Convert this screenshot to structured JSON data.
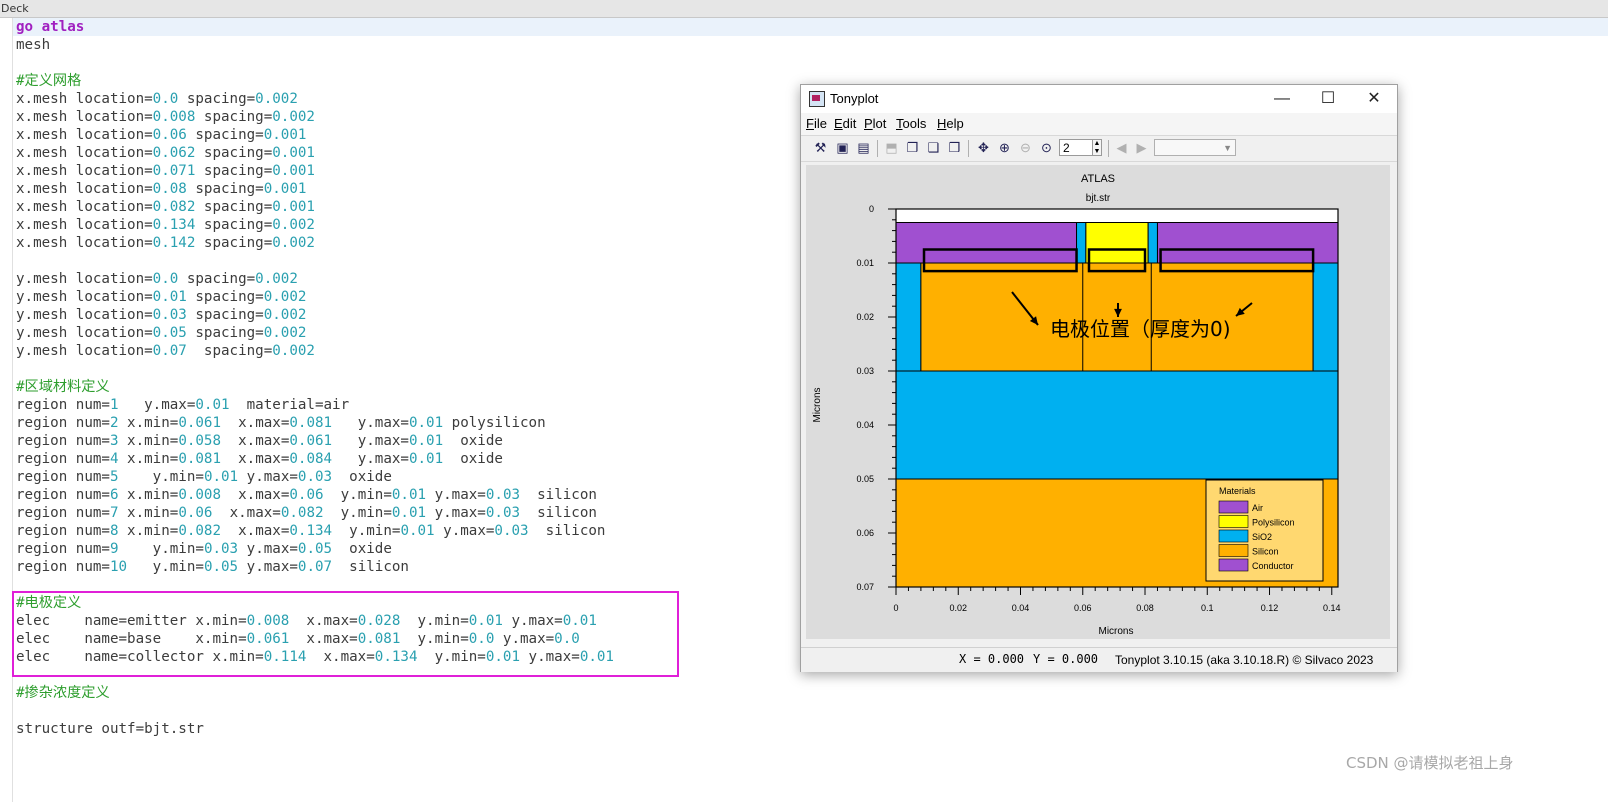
{
  "editor": {
    "tab_label": "Deck",
    "lines": [
      [
        {
          "t": "go atlas",
          "c": "kw"
        }
      ],
      [
        {
          "t": "mesh"
        }
      ],
      [],
      [
        {
          "t": "#定义网格",
          "c": "cmt"
        }
      ],
      [
        {
          "t": "x.mesh location="
        },
        {
          "t": "0.0",
          "c": "num"
        },
        {
          "t": " spacing="
        },
        {
          "t": "0.002",
          "c": "num"
        }
      ],
      [
        {
          "t": "x.mesh location="
        },
        {
          "t": "0.008",
          "c": "num"
        },
        {
          "t": " spacing="
        },
        {
          "t": "0.002",
          "c": "num"
        }
      ],
      [
        {
          "t": "x.mesh location="
        },
        {
          "t": "0.06",
          "c": "num"
        },
        {
          "t": " spacing="
        },
        {
          "t": "0.001",
          "c": "num"
        }
      ],
      [
        {
          "t": "x.mesh location="
        },
        {
          "t": "0.062",
          "c": "num"
        },
        {
          "t": " spacing="
        },
        {
          "t": "0.001",
          "c": "num"
        }
      ],
      [
        {
          "t": "x.mesh location="
        },
        {
          "t": "0.071",
          "c": "num"
        },
        {
          "t": " spacing="
        },
        {
          "t": "0.001",
          "c": "num"
        }
      ],
      [
        {
          "t": "x.mesh location="
        },
        {
          "t": "0.08",
          "c": "num"
        },
        {
          "t": " spacing="
        },
        {
          "t": "0.001",
          "c": "num"
        }
      ],
      [
        {
          "t": "x.mesh location="
        },
        {
          "t": "0.082",
          "c": "num"
        },
        {
          "t": " spacing="
        },
        {
          "t": "0.001",
          "c": "num"
        }
      ],
      [
        {
          "t": "x.mesh location="
        },
        {
          "t": "0.134",
          "c": "num"
        },
        {
          "t": " spacing="
        },
        {
          "t": "0.002",
          "c": "num"
        }
      ],
      [
        {
          "t": "x.mesh location="
        },
        {
          "t": "0.142",
          "c": "num"
        },
        {
          "t": " spacing="
        },
        {
          "t": "0.002",
          "c": "num"
        }
      ],
      [],
      [
        {
          "t": "y.mesh location="
        },
        {
          "t": "0.0",
          "c": "num"
        },
        {
          "t": " spacing="
        },
        {
          "t": "0.002",
          "c": "num"
        }
      ],
      [
        {
          "t": "y.mesh location="
        },
        {
          "t": "0.01",
          "c": "num"
        },
        {
          "t": " spacing="
        },
        {
          "t": "0.002",
          "c": "num"
        }
      ],
      [
        {
          "t": "y.mesh location="
        },
        {
          "t": "0.03",
          "c": "num"
        },
        {
          "t": " spacing="
        },
        {
          "t": "0.002",
          "c": "num"
        }
      ],
      [
        {
          "t": "y.mesh location="
        },
        {
          "t": "0.05",
          "c": "num"
        },
        {
          "t": " spacing="
        },
        {
          "t": "0.002",
          "c": "num"
        }
      ],
      [
        {
          "t": "y.mesh location="
        },
        {
          "t": "0.07",
          "c": "num"
        },
        {
          "t": "  spacing="
        },
        {
          "t": "0.002",
          "c": "num"
        }
      ],
      [],
      [
        {
          "t": "#区域材料定义",
          "c": "cmt"
        }
      ],
      [
        {
          "t": "region num="
        },
        {
          "t": "1",
          "c": "num"
        },
        {
          "t": "   y.max="
        },
        {
          "t": "0.01",
          "c": "num"
        },
        {
          "t": "  material=air"
        }
      ],
      [
        {
          "t": "region num="
        },
        {
          "t": "2",
          "c": "num"
        },
        {
          "t": " x.min="
        },
        {
          "t": "0.061",
          "c": "num"
        },
        {
          "t": "  x.max="
        },
        {
          "t": "0.081",
          "c": "num"
        },
        {
          "t": "   y.max="
        },
        {
          "t": "0.01",
          "c": "num"
        },
        {
          "t": " polysilicon"
        }
      ],
      [
        {
          "t": "region num="
        },
        {
          "t": "3",
          "c": "num"
        },
        {
          "t": " x.min="
        },
        {
          "t": "0.058",
          "c": "num"
        },
        {
          "t": "  x.max="
        },
        {
          "t": "0.061",
          "c": "num"
        },
        {
          "t": "   y.max="
        },
        {
          "t": "0.01",
          "c": "num"
        },
        {
          "t": "  oxide"
        }
      ],
      [
        {
          "t": "region num="
        },
        {
          "t": "4",
          "c": "num"
        },
        {
          "t": " x.min="
        },
        {
          "t": "0.081",
          "c": "num"
        },
        {
          "t": "  x.max="
        },
        {
          "t": "0.084",
          "c": "num"
        },
        {
          "t": "   y.max="
        },
        {
          "t": "0.01",
          "c": "num"
        },
        {
          "t": "  oxide"
        }
      ],
      [
        {
          "t": "region num="
        },
        {
          "t": "5",
          "c": "num"
        },
        {
          "t": "    y.min="
        },
        {
          "t": "0.01",
          "c": "num"
        },
        {
          "t": " y.max="
        },
        {
          "t": "0.03",
          "c": "num"
        },
        {
          "t": "  oxide"
        }
      ],
      [
        {
          "t": "region num="
        },
        {
          "t": "6",
          "c": "num"
        },
        {
          "t": " x.min="
        },
        {
          "t": "0.008",
          "c": "num"
        },
        {
          "t": "  x.max="
        },
        {
          "t": "0.06",
          "c": "num"
        },
        {
          "t": "  y.min="
        },
        {
          "t": "0.01",
          "c": "num"
        },
        {
          "t": " y.max="
        },
        {
          "t": "0.03",
          "c": "num"
        },
        {
          "t": "  silicon"
        }
      ],
      [
        {
          "t": "region num="
        },
        {
          "t": "7",
          "c": "num"
        },
        {
          "t": " x.min="
        },
        {
          "t": "0.06",
          "c": "num"
        },
        {
          "t": "  x.max="
        },
        {
          "t": "0.082",
          "c": "num"
        },
        {
          "t": "  y.min="
        },
        {
          "t": "0.01",
          "c": "num"
        },
        {
          "t": " y.max="
        },
        {
          "t": "0.03",
          "c": "num"
        },
        {
          "t": "  silicon"
        }
      ],
      [
        {
          "t": "region num="
        },
        {
          "t": "8",
          "c": "num"
        },
        {
          "t": " x.min="
        },
        {
          "t": "0.082",
          "c": "num"
        },
        {
          "t": "  x.max="
        },
        {
          "t": "0.134",
          "c": "num"
        },
        {
          "t": "  y.min="
        },
        {
          "t": "0.01",
          "c": "num"
        },
        {
          "t": " y.max="
        },
        {
          "t": "0.03",
          "c": "num"
        },
        {
          "t": "  silicon"
        }
      ],
      [
        {
          "t": "region num="
        },
        {
          "t": "9",
          "c": "num"
        },
        {
          "t": "    y.min="
        },
        {
          "t": "0.03",
          "c": "num"
        },
        {
          "t": " y.max="
        },
        {
          "t": "0.05",
          "c": "num"
        },
        {
          "t": "  oxide"
        }
      ],
      [
        {
          "t": "region num="
        },
        {
          "t": "10",
          "c": "num"
        },
        {
          "t": "   y.min="
        },
        {
          "t": "0.05",
          "c": "num"
        },
        {
          "t": " y.max="
        },
        {
          "t": "0.07",
          "c": "num"
        },
        {
          "t": "  silicon"
        }
      ],
      [],
      [
        {
          "t": "#电极定义",
          "c": "cmt"
        }
      ],
      [
        {
          "t": "elec    name=emitter x.min="
        },
        {
          "t": "0.008",
          "c": "num"
        },
        {
          "t": "  x.max="
        },
        {
          "t": "0.028",
          "c": "num"
        },
        {
          "t": "  y.min="
        },
        {
          "t": "0.01",
          "c": "num"
        },
        {
          "t": " y.max="
        },
        {
          "t": "0.01",
          "c": "num"
        }
      ],
      [
        {
          "t": "elec    name=base    x.min="
        },
        {
          "t": "0.061",
          "c": "num"
        },
        {
          "t": "  x.max="
        },
        {
          "t": "0.081",
          "c": "num"
        },
        {
          "t": "  y.min="
        },
        {
          "t": "0.0",
          "c": "num"
        },
        {
          "t": " y.max="
        },
        {
          "t": "0.0",
          "c": "num"
        }
      ],
      [
        {
          "t": "elec    name=collector x.min="
        },
        {
          "t": "0.114",
          "c": "num"
        },
        {
          "t": "  x.max="
        },
        {
          "t": "0.134",
          "c": "num"
        },
        {
          "t": "  y.min="
        },
        {
          "t": "0.01",
          "c": "num"
        },
        {
          "t": " y.max="
        },
        {
          "t": "0.01",
          "c": "num"
        }
      ],
      [],
      [
        {
          "t": "#掺杂浓度定义",
          "c": "cmt"
        }
      ],
      [],
      [
        {
          "t": "structure outf=bjt.str"
        }
      ]
    ]
  },
  "tonyplot": {
    "title": "Tonyplot",
    "menus": [
      {
        "label": "File",
        "u": "F",
        "rest": "ile"
      },
      {
        "label": "Edit",
        "u": "E",
        "rest": "dit"
      },
      {
        "label": "Plot",
        "u": "P",
        "rest": "lot"
      },
      {
        "label": "Tools",
        "u": "T",
        "rest": "ools"
      },
      {
        "label": "Help",
        "u": "H",
        "rest": "elp"
      }
    ],
    "zoom_value": "2",
    "status": {
      "x_label": "X = 0.000",
      "y_label": "Y = 0.000",
      "version": "Tonyplot 3.10.15 (aka 3.10.18.R) © Silvaco 2023"
    }
  },
  "chart_data": {
    "type": "structure",
    "title": "ATLAS",
    "subtitle": "bjt.str",
    "xlabel": "Microns",
    "ylabel": "Microns",
    "xlim": [
      0,
      0.142
    ],
    "ylim": [
      0.07,
      0
    ],
    "xticks": [
      "0",
      "0.02",
      "0.04",
      "0.06",
      "0.08",
      "0.1",
      "0.12",
      "0.14"
    ],
    "yticks": [
      "0",
      "0.01",
      "0.02",
      "0.03",
      "0.04",
      "0.05",
      "0.06",
      "0.07"
    ],
    "regions": [
      {
        "material": "Air",
        "x": [
          0,
          0.142
        ],
        "y": [
          0,
          0.0025
        ]
      },
      {
        "material": "Conductor",
        "x": [
          0,
          0.058
        ],
        "y": [
          0.0025,
          0.01
        ]
      },
      {
        "material": "SiO2",
        "x": [
          0.058,
          0.061
        ],
        "y": [
          0.0025,
          0.01
        ]
      },
      {
        "material": "Polysilicon",
        "x": [
          0.061,
          0.081
        ],
        "y": [
          0.0025,
          0.01
        ]
      },
      {
        "material": "SiO2",
        "x": [
          0.081,
          0.084
        ],
        "y": [
          0.0025,
          0.01
        ]
      },
      {
        "material": "Conductor",
        "x": [
          0.084,
          0.142
        ],
        "y": [
          0.0025,
          0.01
        ]
      },
      {
        "material": "SiO2",
        "x": [
          0,
          0.008
        ],
        "y": [
          0.01,
          0.03
        ]
      },
      {
        "material": "Silicon",
        "x": [
          0.008,
          0.134
        ],
        "y": [
          0.01,
          0.03
        ]
      },
      {
        "material": "SiO2",
        "x": [
          0.134,
          0.142
        ],
        "y": [
          0.01,
          0.03
        ]
      },
      {
        "material": "SiO2",
        "x": [
          0,
          0.142
        ],
        "y": [
          0.03,
          0.05
        ]
      },
      {
        "material": "Silicon",
        "x": [
          0,
          0.142
        ],
        "y": [
          0.05,
          0.07
        ]
      }
    ],
    "boundaries": [
      0.06,
      0.082
    ],
    "electrodes": [
      {
        "x": [
          0.009,
          0.058
        ],
        "y": [
          0.0075,
          0.0115
        ]
      },
      {
        "x": [
          0.062,
          0.08
        ],
        "y": [
          0.0075,
          0.0115
        ]
      },
      {
        "x": [
          0.085,
          0.134
        ],
        "y": [
          0.0075,
          0.0115
        ]
      }
    ],
    "annotation": "电极位置（厚度为0)",
    "legend": {
      "title": "Materials",
      "position": "bottom-right",
      "items": [
        {
          "name": "Air",
          "color": "#a050d0"
        },
        {
          "name": "Polysilicon",
          "color": "#ffff00"
        },
        {
          "name": "SiO2",
          "color": "#00b0f0"
        },
        {
          "name": "Silicon",
          "color": "#ffb000"
        },
        {
          "name": "Conductor",
          "color": "#a050d0"
        }
      ]
    },
    "colors": {
      "Air": "#ffffff",
      "Conductor": "#a050d0",
      "SiO2": "#00b0f0",
      "Polysilicon": "#ffff00",
      "Silicon": "#ffb000"
    }
  },
  "watermark": "CSDN @请模拟老祖上身"
}
